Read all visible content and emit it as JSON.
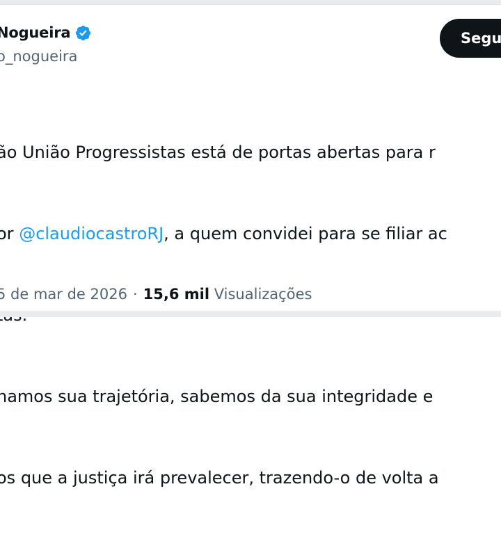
{
  "author": {
    "display_name": "Nogueira",
    "handle": "o_nogueira",
    "verified": true
  },
  "follow_button": {
    "label": "Segu"
  },
  "tweet": {
    "line1": "ão União Progressistas está de portas abertas para r",
    "line2_prefix": "or ",
    "line2_mention": "@claudiocastroRJ",
    "line2_suffix": ", a quem convidei para se filiar ac",
    "line3": "tas.",
    "line4": "hamos sua trajetória, sabemos da sua integridade e",
    "line5": "os que a justiça irá prevalecer, trazendo-o de volta a"
  },
  "meta": {
    "date": "5 de mar de 2026",
    "separator": "·",
    "views_count": "15,6 mil",
    "views_label": "Visualizações"
  },
  "colors": {
    "accent": "#1d9bf0",
    "text": "#0f1419",
    "muted": "#536471",
    "button_bg": "#0f1419"
  },
  "icons": {
    "verified": "verified-badge-icon"
  }
}
